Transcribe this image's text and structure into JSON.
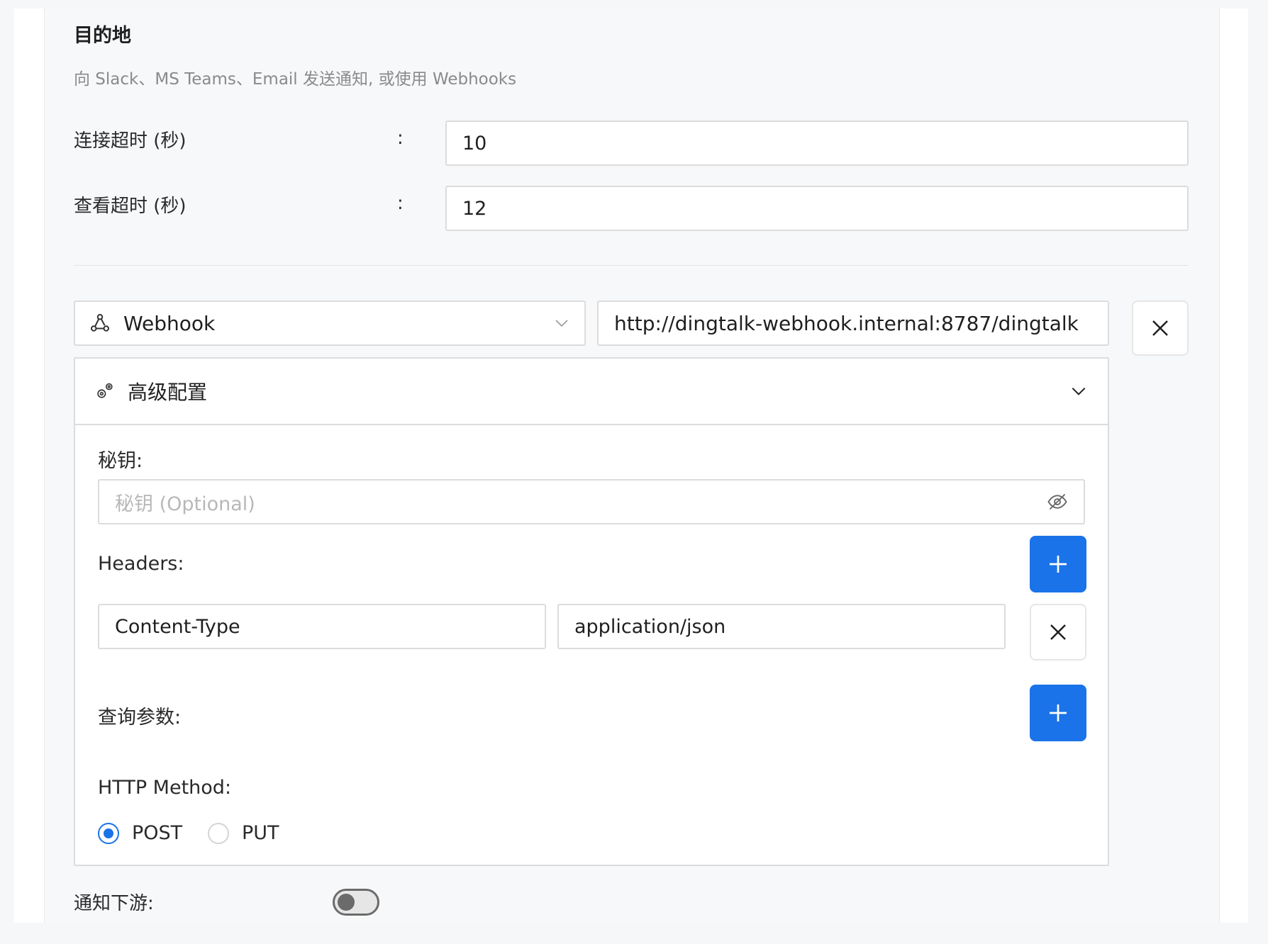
{
  "section": {
    "title": "目的地",
    "subtitle": "向 Slack、MS Teams、Email 发送通知, 或使用 Webhooks"
  },
  "connect_timeout": {
    "label": "连接超时 (秒)",
    "colon": ":",
    "value": "10"
  },
  "read_timeout": {
    "label": "查看超时 (秒)",
    "colon": ":",
    "value": "12"
  },
  "destination": {
    "type_icon": "webhook-icon",
    "type_label": "Webhook",
    "url": "http://dingtalk-webhook.internal:8787/dingtalk",
    "remove_icon": "close-icon"
  },
  "advanced": {
    "icon": "gears-icon",
    "title": "高级配置",
    "expand_icon": "chevron-down-icon",
    "secret": {
      "label": "秘钥:",
      "placeholder": "秘钥 (Optional)",
      "value": "",
      "visibility_icon": "eye-off-icon"
    },
    "headers": {
      "label": "Headers:",
      "add_icon": "plus-icon",
      "items": [
        {
          "key": "Content-Type",
          "value": "application/json"
        }
      ]
    },
    "query_params": {
      "label": "查询参数:",
      "add_icon": "plus-icon"
    },
    "http_method": {
      "label": "HTTP Method:",
      "options": [
        {
          "label": "POST",
          "selected": true
        },
        {
          "label": "PUT",
          "selected": false
        }
      ]
    }
  },
  "notify_downstream": {
    "label": "通知下游:",
    "enabled": false
  },
  "colors": {
    "primary": "#1a73e8",
    "border": "#dcdcdc",
    "muted_text": "#8a8a8a"
  }
}
